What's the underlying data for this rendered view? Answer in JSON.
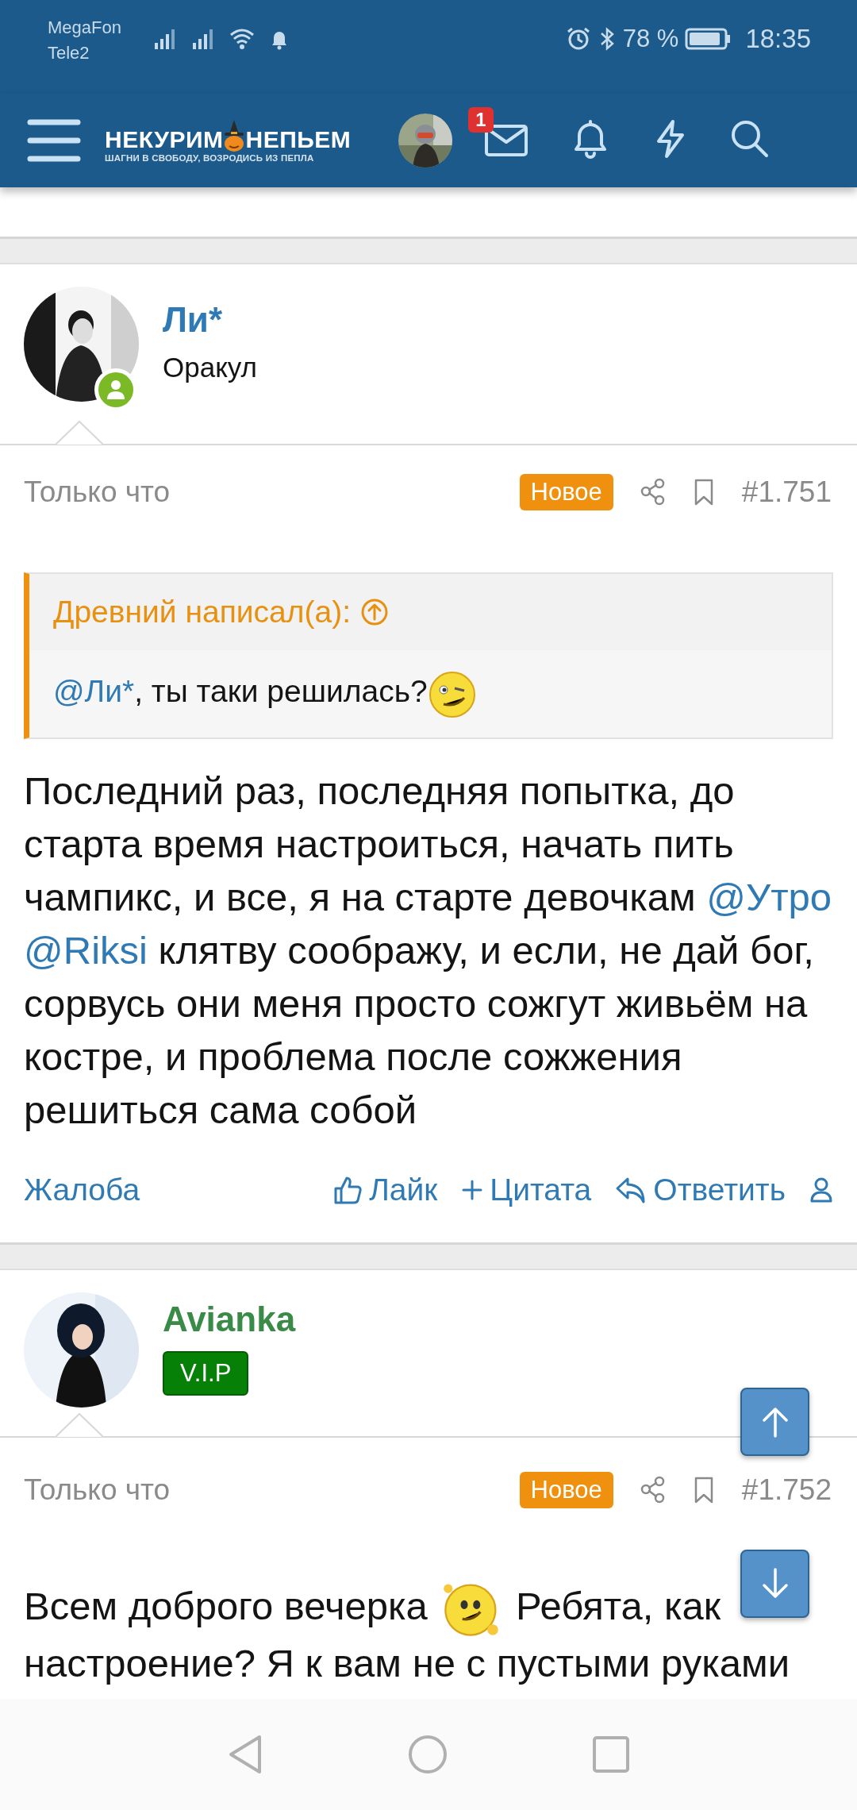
{
  "status_bar": {
    "carriers": [
      "MegaFon",
      "Tele2"
    ],
    "battery": "78 %",
    "time": "18:35"
  },
  "header": {
    "logo_left": "НЕКУРИМ",
    "logo_right": "НЕПЬЕМ",
    "tagline": "ШАГНИ В СВОБОДУ, ВОЗРОДИСЬ ИЗ ПЕПЛА",
    "messages_badge": "1"
  },
  "posts": [
    {
      "author": "Ли*",
      "online": true,
      "user_title": {
        "kind": "rank",
        "text": "Оракул"
      },
      "time": "Только что",
      "new_label": "Новое",
      "number": "#1.751",
      "quote": {
        "author_line": "Древний написал(а):",
        "segments": [
          {
            "kind": "mention",
            "text": "@Ли*"
          },
          {
            "kind": "text",
            "text": ", ты таки решилась?"
          },
          {
            "kind": "smiley"
          }
        ]
      },
      "body": [
        {
          "kind": "text",
          "text": "Последний раз, последняя попытка, до старта время настроиться, начать пить чампикс, и все, я на старте девочкам "
        },
        {
          "kind": "mention",
          "text": "@Утро"
        },
        {
          "kind": "mention",
          "text": "@Riksi"
        },
        {
          "kind": "text",
          "text": " клятву соображу, и если, не дай бог, сорвусь они меня просто сожгут живьём на костре, и проблема после сожжения решиться сама собой"
        }
      ],
      "actions": [
        {
          "kind": "report",
          "label": "Жалоба"
        },
        {
          "kind": "like",
          "label": "Лайк"
        },
        {
          "kind": "quote",
          "label": "Цитата"
        },
        {
          "kind": "reply",
          "label": "Ответить"
        }
      ]
    },
    {
      "author": "Avianka",
      "online": false,
      "user_title": {
        "kind": "badge",
        "text": "V.I.P"
      },
      "time": "Только что",
      "new_label": "Новое",
      "number": "#1.752",
      "body": [
        {
          "kind": "text",
          "text": "Всем доброго вечерка "
        },
        {
          "kind": "smiley"
        },
        {
          "kind": "text",
          "text": " Ребята, как"
        },
        {
          "kind": "break"
        },
        {
          "kind": "text",
          "text": "настроение? Я к вам не с пустыми руками"
        }
      ]
    }
  ]
}
